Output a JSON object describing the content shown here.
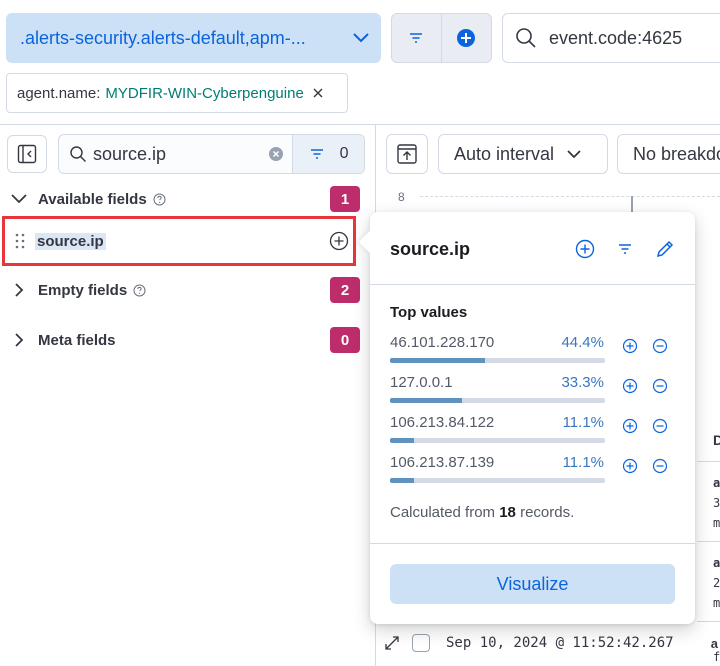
{
  "topbar": {
    "data_view": ".alerts-security.alerts-default,apm-...",
    "query": "event.code:4625"
  },
  "filter_pill": {
    "key": "agent.name:",
    "value": "MYDFIR-WIN-Cyberpenguine"
  },
  "sidebar": {
    "search_value": "source.ip",
    "filter_count": "0",
    "groups": {
      "available": {
        "label": "Available fields",
        "count": "1"
      },
      "empty": {
        "label": "Empty fields",
        "count": "2"
      },
      "meta": {
        "label": "Meta fields",
        "count": "0"
      }
    },
    "selected_field": "source.ip"
  },
  "main": {
    "interval_label": "Auto interval",
    "breakdown_label": "No breakdo",
    "y_tick": "8",
    "doc_col_head": "D",
    "row_fragments": [
      "a",
      "3",
      "m",
      "a",
      "2",
      "m",
      "a",
      "f"
    ],
    "bottom_timestamp": "Sep 10, 2024 @ 11:52:42.267",
    "bottom_more": "a"
  },
  "popover": {
    "title": "source.ip",
    "top_values_title": "Top values",
    "values": [
      {
        "value": "46.101.228.170",
        "percent": "44.4%",
        "fraction": 0.444
      },
      {
        "value": "127.0.0.1",
        "percent": "33.3%",
        "fraction": 0.333
      },
      {
        "value": "106.213.84.122",
        "percent": "11.1%",
        "fraction": 0.111
      },
      {
        "value": "106.213.87.139",
        "percent": "11.1%",
        "fraction": 0.111
      }
    ],
    "calc_prefix": "Calculated from",
    "calc_count": "18",
    "calc_suffix": "records.",
    "visualize_label": "Visualize"
  },
  "colors": {
    "accent": "#0b64dd",
    "badge": "#bd2d6b",
    "highlight_border": "#e7353c",
    "bar_fill": "#6092c0"
  }
}
